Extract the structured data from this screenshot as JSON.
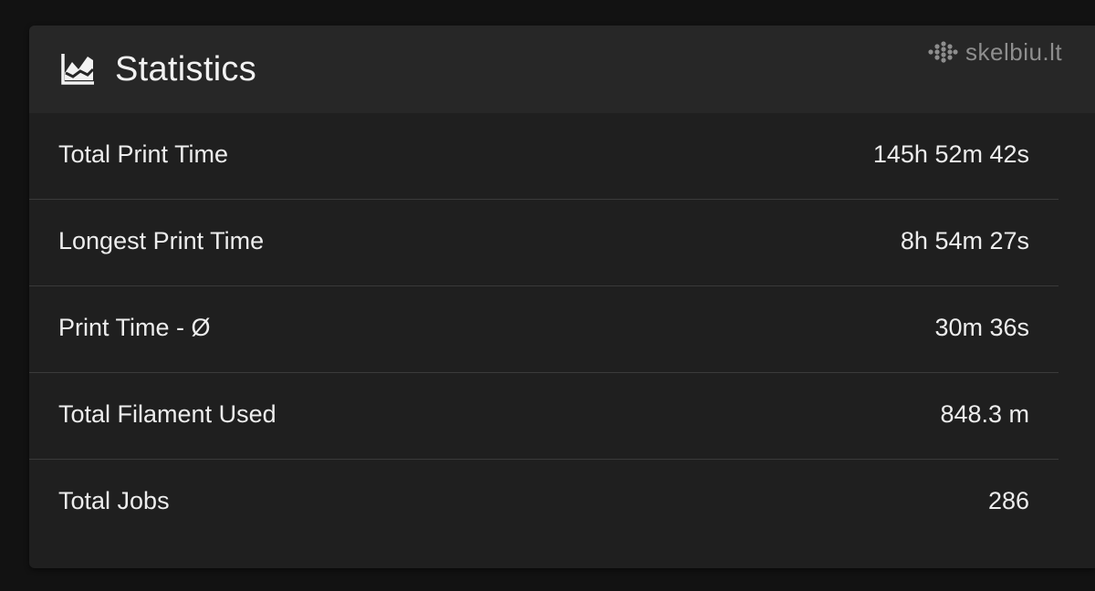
{
  "header": {
    "title": "Statistics",
    "icon": "chart-line-icon"
  },
  "watermark": {
    "text": "skelbiu.lt",
    "icon": "dots-logo-icon"
  },
  "stats": [
    {
      "label": "Total Print Time",
      "value": "145h 52m 42s"
    },
    {
      "label": "Longest Print Time",
      "value": "8h 54m 27s"
    },
    {
      "label": "Print Time - Ø",
      "value": "30m 36s"
    },
    {
      "label": "Total Filament Used",
      "value": "848.3 m"
    },
    {
      "label": "Total Jobs",
      "value": "286"
    }
  ],
  "colors": {
    "background": "#121212",
    "card": "#1f1f1f",
    "header": "#272727",
    "text": "#ededed",
    "divider": "#3a3a3a"
  }
}
